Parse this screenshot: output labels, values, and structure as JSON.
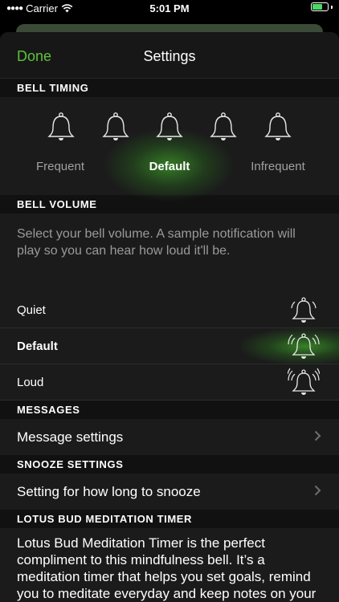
{
  "status_bar": {
    "carrier": "Carrier",
    "time": "5:01 PM"
  },
  "nav": {
    "done_label": "Done",
    "title": "Settings"
  },
  "bell_timing": {
    "header": "BELL TIMING",
    "labels": {
      "frequent": "Frequent",
      "default": "Default",
      "infrequent": "Infrequent"
    },
    "selected": "Default",
    "bell_icon": "bell-icon"
  },
  "bell_volume": {
    "header": "BELL VOLUME",
    "description": "Select your bell volume.  A sample notification will play so you can hear how loud it'll be.",
    "options": [
      {
        "label": "Quiet",
        "icon": "bell-quiet-icon"
      },
      {
        "label": "Default",
        "icon": "bell-default-icon"
      },
      {
        "label": "Loud",
        "icon": "bell-loud-icon"
      }
    ],
    "selected": "Default"
  },
  "messages": {
    "header": "MESSAGES",
    "row_label": "Message settings"
  },
  "snooze": {
    "header": "SNOOZE SETTINGS",
    "row_label": "Setting for how long to snooze"
  },
  "promo": {
    "header": "LOTUS BUD MEDITATION TIMER",
    "body": "Lotus Bud Meditation Timer is the perfect compliment to this mindfulness bell.  It’s a meditation timer that helps you set goals, remind you to meditate everyday and keep notes on your daily practice."
  },
  "colors": {
    "accent_green": "#5ec23a",
    "glow_green": "#3a8c28",
    "background": "#1b1b1b",
    "section_header_bg": "#111111"
  }
}
